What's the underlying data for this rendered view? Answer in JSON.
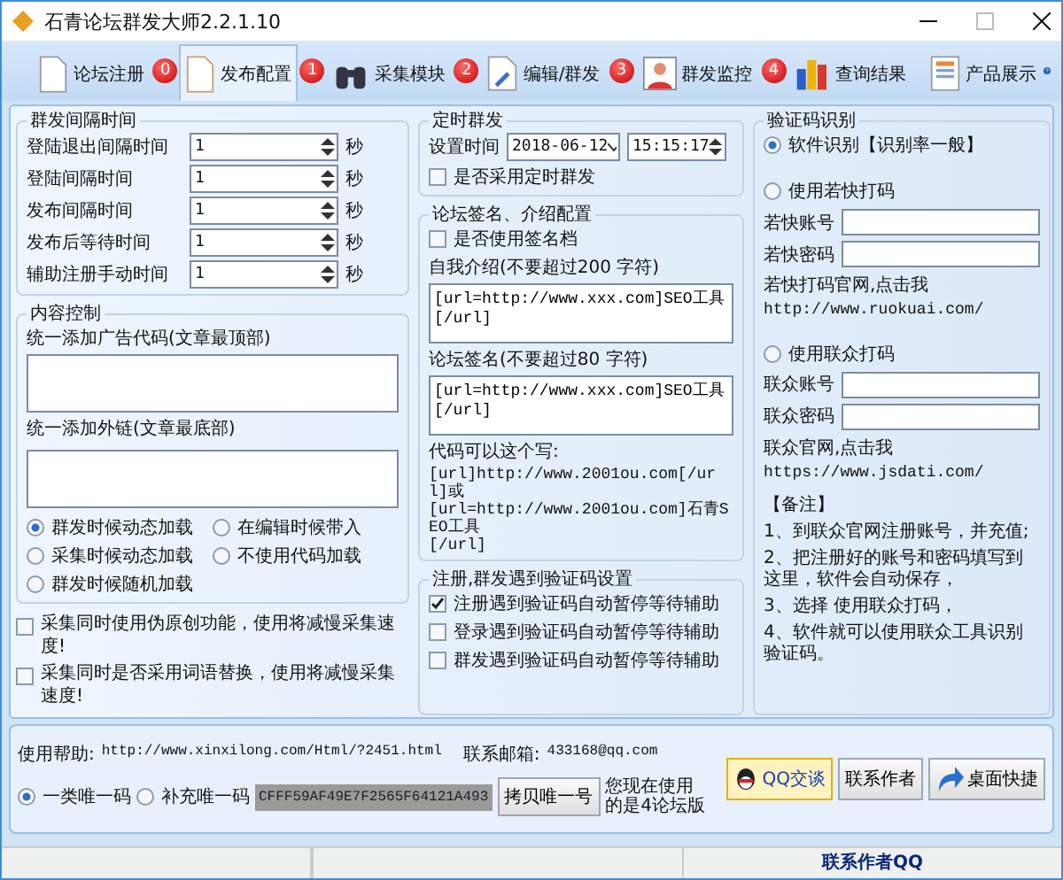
{
  "window": {
    "title": "石青论坛群发大师2.2.1.10"
  },
  "tabs": [
    {
      "label": "论坛注册",
      "selected": false
    },
    {
      "label": "发布配置",
      "badge": "0",
      "selected": true
    },
    {
      "label": "采集模块",
      "badge": "1",
      "selected": false
    },
    {
      "label": "编辑/群发",
      "badge": "2",
      "selected": false
    },
    {
      "label": "群发监控",
      "badge": "3",
      "selected": false
    },
    {
      "label": "查询结果",
      "badge": "4",
      "selected": false
    },
    {
      "label": "产品展示",
      "selected": false
    }
  ],
  "interval_group": {
    "title": "群发间隔时间",
    "rows": [
      {
        "label": "登陆退出间隔时间",
        "value": "1",
        "unit": "秒"
      },
      {
        "label": "登陆间隔时间",
        "value": "1",
        "unit": "秒"
      },
      {
        "label": "发布间隔时间",
        "value": "1",
        "unit": "秒"
      },
      {
        "label": "发布后等待时间",
        "value": "1",
        "unit": "秒"
      },
      {
        "label": "辅助注册手动时间",
        "value": "1",
        "unit": "秒"
      }
    ]
  },
  "content_group": {
    "title": "内容控制",
    "top_label": "统一添加广告代码(文章最顶部)",
    "bottom_label": "统一添加外链(文章最底部)",
    "load_options": [
      {
        "label": "群发时候动态加载",
        "selected": true
      },
      {
        "label": "在编辑时候带入",
        "selected": false
      },
      {
        "label": "采集时候动态加载",
        "selected": false
      },
      {
        "label": "不使用代码加载",
        "selected": false
      },
      {
        "label": "群发时候随机加载",
        "selected": false
      }
    ]
  },
  "collect_options": [
    {
      "label": "采集同时使用伪原创功能，使用将减慢采集速度!",
      "checked": false
    },
    {
      "label": "采集同时是否采用词语替换，使用将减慢采集速度!",
      "checked": false
    }
  ],
  "timer_group": {
    "title": "定时群发",
    "time_label": "设置时间",
    "date": "2018-06-12",
    "time": "15:15:17",
    "use_timer": {
      "label": "是否采用定时群发",
      "checked": false
    }
  },
  "signature_group": {
    "title": "论坛签名、介绍配置",
    "use_signature": {
      "label": "是否使用签名档",
      "checked": false
    },
    "intro_label": "自我介绍(不要超过200 字符)",
    "intro_value": "[url=http://www.xxx.com]SEO工具[/url]",
    "sign_label": "论坛签名(不要超过80 字符)",
    "sign_value": "[url=http://www.xxx.com]SEO工具[/url]",
    "hint_title": "代码可以这个写:",
    "hint_code": "[url]http://www.2001ou.com[/url]或\n[url=http://www.2001ou.com]石青SEO工具\n[/url]"
  },
  "captcha_pause_group": {
    "title": "注册,群发遇到验证码设置",
    "options": [
      {
        "label": "注册遇到验证码自动暂停等待辅助",
        "checked": true
      },
      {
        "label": "登录遇到验证码自动暂停等待辅助",
        "checked": false
      },
      {
        "label": "群发遇到验证码自动暂停等待辅助",
        "checked": false
      }
    ]
  },
  "captcha_group": {
    "title": "验证码识别",
    "software": {
      "label": "软件识别【识别率一般】",
      "selected": true
    },
    "ruokuai": {
      "label": "使用若快打码",
      "selected": false,
      "account_label": "若快账号",
      "password_label": "若快密码",
      "site_text": "若快打码官网,点击我",
      "site_url": "http://www.ruokuai.com/"
    },
    "lianzhong": {
      "label": "使用联众打码",
      "selected": false,
      "account_label": "联众账号",
      "password_label": "联众密码",
      "site_text": "联众官网,点击我",
      "site_url": "https://www.jsdati.com/"
    },
    "notes": [
      "【备注】",
      "1、到联众官网注册账号，并充值;",
      "2、把注册好的账号和密码填写到这里，软件会自动保存，",
      "3、选择 使用联众打码，",
      "4、软件就可以使用联众工具识别验证码。"
    ]
  },
  "bottom_bar": {
    "help_label": "使用帮助:",
    "help_url": "http://www.xinxilong.com/Html/?2451.html",
    "email_label": "联系邮箱:",
    "email": "433168@qq.com",
    "code_options": [
      {
        "label": "一类唯一码",
        "selected": true
      },
      {
        "label": "补充唯一码",
        "selected": false
      }
    ],
    "unique_code": "CFFF59AF49E7F2565F64121A493",
    "copy_button": "拷贝唯一号",
    "edition_text": "您现在使用的是4论坛版",
    "qq_button": "QQ交谈",
    "contact_button": "联系作者",
    "shortcut_button": "桌面快捷"
  },
  "status_bar": [
    "联系作者QQ"
  ]
}
